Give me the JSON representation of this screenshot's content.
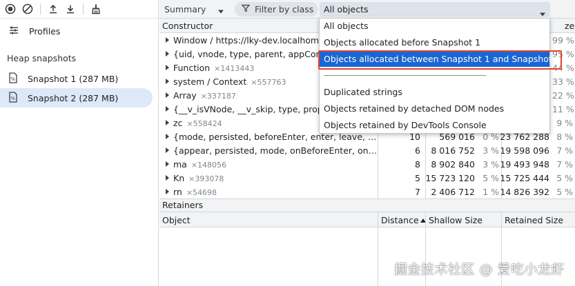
{
  "left": {
    "profiles_label": "Profiles",
    "heap_title": "Heap snapshots",
    "snapshots": [
      {
        "label": "Snapshot 1 (287 MB)",
        "selected": false
      },
      {
        "label": "Snapshot 2 (287 MB)",
        "selected": true
      }
    ],
    "icons": [
      "record-icon",
      "clear-icon",
      "upload-icon",
      "download-icon",
      "collect-garbage-icon",
      "profiles-icon",
      "snapshot-file-icon"
    ]
  },
  "toolbar": {
    "view_select": "Summary",
    "filter_placeholder": "Filter by class",
    "object_select": "All objects"
  },
  "table": {
    "header_constructor": "Constructor",
    "header_tail": "ze",
    "rows": [
      {
        "name": "Window / https://lky-dev.localhome.c",
        "count": "",
        "distance": "",
        "shallow": "",
        "shallow_pct": "",
        "retained": "",
        "retained_pct": "99 %"
      },
      {
        "name": "{uid, vnode, type, parent, appContex",
        "count": "",
        "distance": "",
        "shallow": "",
        "shallow_pct": "",
        "retained": "",
        "retained_pct": "95 %"
      },
      {
        "name": "Function",
        "count": "×1413443",
        "distance": "",
        "shallow": "",
        "shallow_pct": "",
        "retained": "",
        "retained_pct": "44 %"
      },
      {
        "name": "system / Context",
        "count": "×557763",
        "distance": "",
        "shallow": "",
        "shallow_pct": "",
        "retained": "",
        "retained_pct": "33 %"
      },
      {
        "name": "Array",
        "count": "×337187",
        "distance": "",
        "shallow": "",
        "shallow_pct": "",
        "retained": "",
        "retained_pct": "22 %"
      },
      {
        "name": "{__v_isVNode, __v_skip, type, props, k",
        "count": "",
        "distance": "",
        "shallow": "",
        "shallow_pct": "",
        "retained": "",
        "retained_pct": "11 %"
      },
      {
        "name": "zc",
        "count": "×558424",
        "distance": "",
        "shallow": "",
        "shallow_pct": "",
        "retained": "",
        "retained_pct": "9 %"
      },
      {
        "name": "{mode, persisted, beforeEnter, enter, leave, clone}",
        "count": "",
        "distance": "10",
        "shallow": "569 016",
        "shallow_pct": "0 %",
        "retained": "23 762 288",
        "retained_pct": "8 %"
      },
      {
        "name": "{appear, persisted, mode, onBeforeEnter, onEnter,...",
        "count": "",
        "distance": "6",
        "shallow": "8 016 752",
        "shallow_pct": "3 %",
        "retained": "19 598 096",
        "retained_pct": "7 %"
      },
      {
        "name": "ma",
        "count": "×148056",
        "distance": "8",
        "shallow": "8 902 840",
        "shallow_pct": "3 %",
        "retained": "19 493 948",
        "retained_pct": "7 %"
      },
      {
        "name": "Kn",
        "count": "×393078",
        "distance": "5",
        "shallow": "15 723 120",
        "shallow_pct": "5 %",
        "retained": "15 725 444",
        "retained_pct": "5 %"
      },
      {
        "name": "rn",
        "count": "×54698",
        "distance": "7",
        "shallow": "2 406 712",
        "shallow_pct": "1 %",
        "retained": "14 826 392",
        "retained_pct": "5 %"
      }
    ]
  },
  "retainers": {
    "title": "Retainers",
    "headers": {
      "object": "Object",
      "distance": "Distance",
      "shallow": "Shallow Size",
      "retained": "Retained Size"
    }
  },
  "dropdown": {
    "items": [
      {
        "label": "All objects",
        "selected": false
      },
      {
        "label": "Objects allocated before Snapshot 1",
        "selected": false
      },
      {
        "label": "Objects allocated between Snapshot 1 and Snapshot 2",
        "selected": true
      },
      {
        "label": "Duplicated strings",
        "selected": false
      },
      {
        "label": "Objects retained by detached DOM nodes",
        "selected": false
      },
      {
        "label": "Objects retained by DevTools Console",
        "selected": false
      }
    ]
  },
  "watermark": "掘金技术社区 @ 爱吃小龙虾",
  "colors": {
    "selection": "#1a66d2",
    "highlight": "#e0432f",
    "snapshot_selected_bg": "#dde9f8"
  }
}
